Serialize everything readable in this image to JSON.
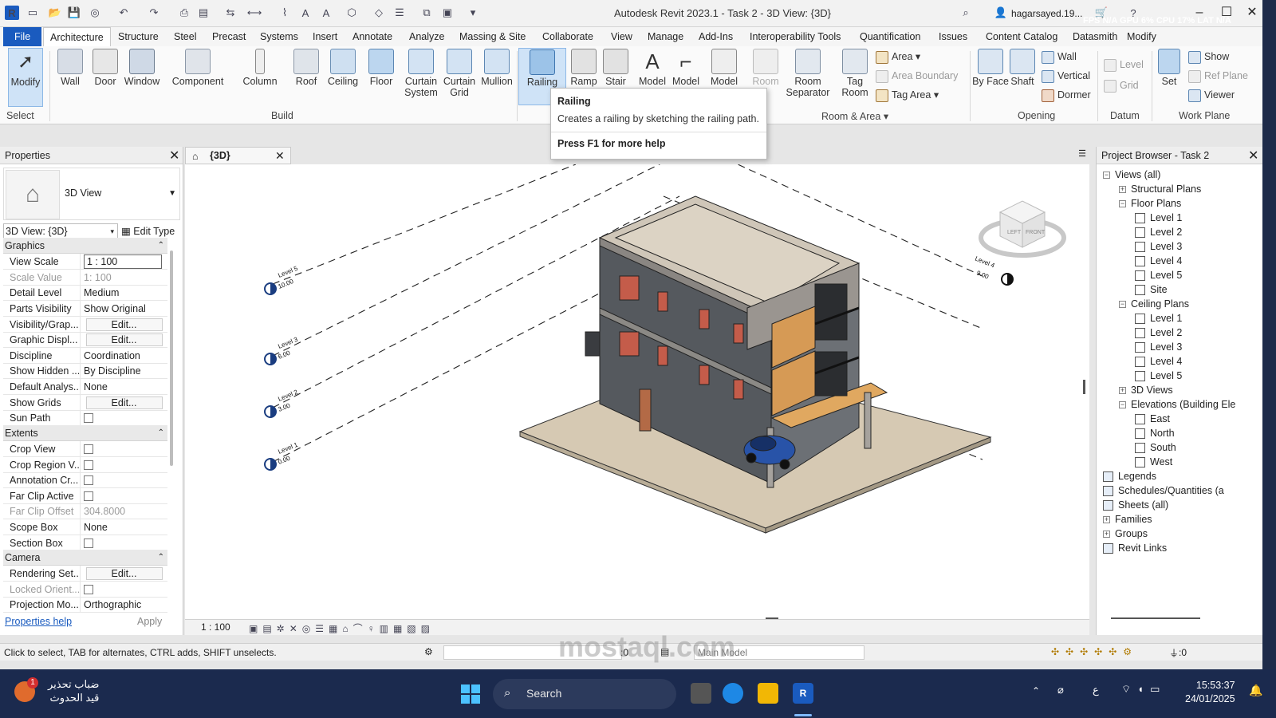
{
  "app": {
    "title": "Autodesk Revit 2023.1 - Task 2 - 3D View: {3D}",
    "user": "hagarsayed.19...",
    "perf": "FPS N/A GPU 6% CPU 17% LAT N/A"
  },
  "tabs": [
    "File",
    "Architecture",
    "Structure",
    "Steel",
    "Precast",
    "Systems",
    "Insert",
    "Annotate",
    "Analyze",
    "Massing & Site",
    "Collaborate",
    "View",
    "Manage",
    "Add-Ins",
    "Interoperability Tools",
    "Quantification",
    "Issues",
    "Content Catalog",
    "Datasmith",
    "Modify"
  ],
  "active_tab": "Architecture",
  "ribbon": {
    "modify": "Modify",
    "select": "Select",
    "build_buttons": [
      "Wall",
      "Door",
      "Window",
      "Component",
      "Column",
      "Roof",
      "Ceiling",
      "Floor",
      "Curtain System",
      "Curtain Grid",
      "Mullion"
    ],
    "build_label": "Build",
    "circulation_buttons": [
      "Railing",
      "Ramp",
      "Stair",
      "Model",
      "Model",
      "Model"
    ],
    "room_buttons": [
      "Room",
      "Room Separator",
      "Tag Room"
    ],
    "room_small": [
      "Area",
      "Area Boundary",
      "Tag Area"
    ],
    "room_label": "Room & Area",
    "opening_buttons": [
      "By Face",
      "Shaft"
    ],
    "opening_small": [
      "Wall",
      "Vertical",
      "Dormer"
    ],
    "opening_label": "Opening",
    "datum_small": [
      "Level",
      "Grid"
    ],
    "datum_label": "Datum",
    "set": "Set",
    "workplane_small": [
      "Show",
      "Ref Plane",
      "Viewer"
    ],
    "workplane_label": "Work Plane"
  },
  "tooltip": {
    "title": "Railing",
    "desc": "Creates a railing by sketching the railing path.",
    "help": "Press F1 for more help"
  },
  "properties": {
    "title": "Properties",
    "type_name": "3D View",
    "view_select": "3D View: {3D}",
    "edit_type": "Edit Type",
    "groups": {
      "graphics": "Graphics",
      "extents": "Extents",
      "camera": "Camera"
    },
    "rows": [
      {
        "k": "View Scale",
        "v": "1 : 100"
      },
      {
        "k": "Scale Value",
        "v": "1:  100"
      },
      {
        "k": "Detail Level",
        "v": "Medium"
      },
      {
        "k": "Parts Visibility",
        "v": "Show Original"
      },
      {
        "k": "Visibility/Grap...",
        "v": "Edit..."
      },
      {
        "k": "Graphic Displ...",
        "v": "Edit..."
      },
      {
        "k": "Discipline",
        "v": "Coordination"
      },
      {
        "k": "Show Hidden ...",
        "v": "By Discipline"
      },
      {
        "k": "Default Analys...",
        "v": "None"
      },
      {
        "k": "Show Grids",
        "v": "Edit..."
      },
      {
        "k": "Sun Path",
        "v": ""
      },
      {
        "k": "Crop View",
        "v": ""
      },
      {
        "k": "Crop Region V...",
        "v": ""
      },
      {
        "k": "Annotation Cr...",
        "v": ""
      },
      {
        "k": "Far Clip Active",
        "v": ""
      },
      {
        "k": "Far Clip Offset",
        "v": "304.8000"
      },
      {
        "k": "Scope Box",
        "v": "None"
      },
      {
        "k": "Section Box",
        "v": ""
      },
      {
        "k": "Rendering Set...",
        "v": "Edit..."
      },
      {
        "k": "Locked Orient...",
        "v": ""
      },
      {
        "k": "Projection Mo...",
        "v": "Orthographic"
      }
    ],
    "help": "Properties help",
    "apply": "Apply"
  },
  "view": {
    "tab": "{3D}",
    "scale": "1 : 100",
    "levels": [
      {
        "name": "Level 5",
        "elev": "10.00"
      },
      {
        "name": "Level 3",
        "elev": "6.00"
      },
      {
        "name": "Level 2",
        "elev": "3.00"
      },
      {
        "name": "Level 1",
        "elev": "0.00"
      },
      {
        "name": "Level 4",
        "elev": "9.00"
      }
    ],
    "viewcube": {
      "left": "LEFT",
      "front": "FRONT",
      "top": "TOP"
    }
  },
  "browser": {
    "title": "Project Browser - Task 2",
    "items": [
      {
        "label": "Views (all)",
        "indent": 0,
        "kind": "minus"
      },
      {
        "label": "Structural Plans",
        "indent": 1,
        "kind": "plus"
      },
      {
        "label": "Floor Plans",
        "indent": 1,
        "kind": "minus"
      },
      {
        "label": "Level 1",
        "indent": 2,
        "kind": "view"
      },
      {
        "label": "Level 2",
        "indent": 2,
        "kind": "view"
      },
      {
        "label": "Level 3",
        "indent": 2,
        "kind": "view"
      },
      {
        "label": "Level 4",
        "indent": 2,
        "kind": "view"
      },
      {
        "label": "Level 5",
        "indent": 2,
        "kind": "view"
      },
      {
        "label": "Site",
        "indent": 2,
        "kind": "view"
      },
      {
        "label": "Ceiling Plans",
        "indent": 1,
        "kind": "minus"
      },
      {
        "label": "Level 1",
        "indent": 2,
        "kind": "view"
      },
      {
        "label": "Level 2",
        "indent": 2,
        "kind": "view"
      },
      {
        "label": "Level 3",
        "indent": 2,
        "kind": "view"
      },
      {
        "label": "Level 4",
        "indent": 2,
        "kind": "view"
      },
      {
        "label": "Level 5",
        "indent": 2,
        "kind": "view"
      },
      {
        "label": "3D Views",
        "indent": 1,
        "kind": "plus"
      },
      {
        "label": "Elevations (Building Ele",
        "indent": 1,
        "kind": "minus"
      },
      {
        "label": "East",
        "indent": 2,
        "kind": "view"
      },
      {
        "label": "North",
        "indent": 2,
        "kind": "view"
      },
      {
        "label": "South",
        "indent": 2,
        "kind": "view"
      },
      {
        "label": "West",
        "indent": 2,
        "kind": "view"
      },
      {
        "label": "Legends",
        "indent": 0,
        "kind": "none"
      },
      {
        "label": "Schedules/Quantities (a",
        "indent": 0,
        "kind": "none"
      },
      {
        "label": "Sheets (all)",
        "indent": 0,
        "kind": "none"
      },
      {
        "label": "Families",
        "indent": 0,
        "kind": "plus"
      },
      {
        "label": "Groups",
        "indent": 0,
        "kind": "plus"
      },
      {
        "label": "Revit Links",
        "indent": 0,
        "kind": "none"
      }
    ]
  },
  "status": {
    "text": "Click to select, TAB for alternates, CTRL adds, SHIFT unselects.",
    "worksets": ":0",
    "model": "Main Model",
    "filter": ":0"
  },
  "taskbar": {
    "weather_line1": "ضباب تحذير",
    "weather_line2": "قيد الحدوث",
    "badge": "1",
    "search": "Search",
    "time": "15:53:37",
    "date": "24/01/2025",
    "lang": "ع"
  },
  "watermark": "mostaql.com"
}
